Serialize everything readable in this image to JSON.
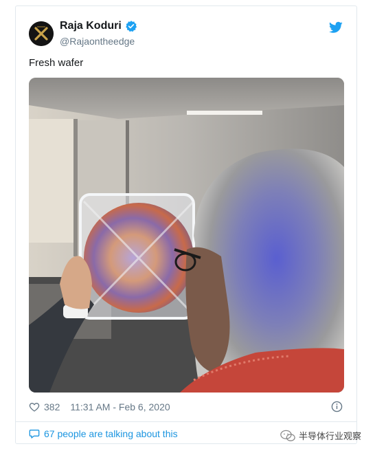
{
  "tweet": {
    "author_name": "Raja Koduri",
    "author_handle": "@Rajaontheedge",
    "text": "Fresh wafer",
    "likes": "382",
    "timestamp": "11:31 AM - Feb 6, 2020",
    "talking": "67 people are talking about this",
    "icons": {
      "avatar": "avatar",
      "verified": "verified-badge-icon",
      "brand": "twitter-bird-icon",
      "like": "heart-icon",
      "info": "info-icon",
      "reply": "speech-bubble-icon"
    },
    "colors": {
      "accent": "#1da1f2",
      "link": "#1b95e0",
      "muted": "#657786",
      "text": "#14171a",
      "border": "#e1e8ed"
    }
  },
  "watermark": {
    "label": "半导体行业观察"
  }
}
